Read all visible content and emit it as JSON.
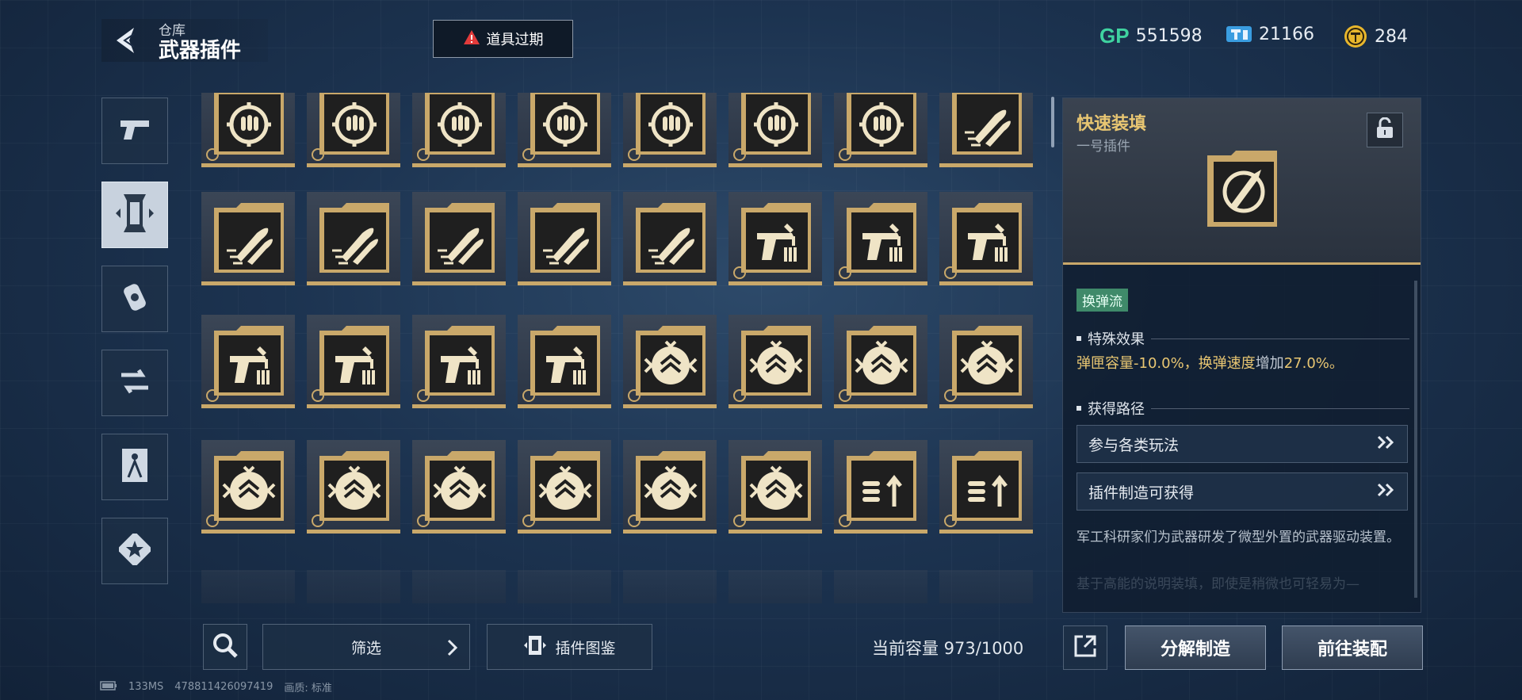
{
  "header": {
    "breadcrumb": "仓库",
    "title": "武器插件",
    "expired_label": "道具过期"
  },
  "currencies": [
    {
      "icon": "gp-icon",
      "value": "551598"
    },
    {
      "icon": "ticket-icon",
      "value": "21166"
    },
    {
      "icon": "coin-icon",
      "value": "284"
    }
  ],
  "categories": [
    {
      "icon": "pistol-icon",
      "active": false
    },
    {
      "icon": "plugin-icon",
      "active": true
    },
    {
      "icon": "grenade-icon",
      "active": false
    },
    {
      "icon": "swap-icon",
      "active": false
    },
    {
      "icon": "figure-icon",
      "active": false
    },
    {
      "icon": "star-icon",
      "active": false
    }
  ],
  "plugins": {
    "rows": [
      [
        "target-ammo",
        "target-ammo",
        "target-ammo",
        "target-ammo",
        "target-ammo",
        "target-ammo",
        "target-ammo",
        "twin-bullets"
      ],
      [
        "twin-bullets",
        "twin-bullets",
        "twin-bullets",
        "twin-bullets",
        "twin-bullets",
        "pistol-mag",
        "pistol-mag",
        "pistol-mag"
      ],
      [
        "pistol-mag",
        "pistol-mag",
        "pistol-mag",
        "pistol-mag",
        "chevron-shield",
        "chevron-shield",
        "chevron-shield",
        "chevron-shield"
      ],
      [
        "chevron-shield",
        "chevron-shield",
        "chevron-shield",
        "chevron-shield",
        "chevron-shield",
        "chevron-shield",
        "ammo-up",
        "ammo-up"
      ]
    ],
    "badges": [
      [
        true,
        true,
        true,
        true,
        true,
        true,
        true,
        false
      ],
      [
        false,
        false,
        false,
        false,
        false,
        true,
        true,
        true
      ],
      [
        true,
        true,
        true,
        true,
        true,
        true,
        true,
        true
      ],
      [
        true,
        true,
        true,
        true,
        true,
        true,
        true,
        true
      ]
    ]
  },
  "detail": {
    "name": "快速装填",
    "slot": "一号插件",
    "tag": "换弹流",
    "special_title": "特殊效果",
    "effect_a": "弹匣容量-10.0%，换弹速度",
    "effect_mid": "增加",
    "effect_b": "27.0%。",
    "route_title": "获得路径",
    "routes": [
      "参与各类玩法",
      "插件制造可获得"
    ],
    "description": "军工科研家们为武器研发了微型外置的武器驱动装置。",
    "description_fade": "基于高能的说明装填，即使是稍微也可轻易为—"
  },
  "bottom": {
    "filter_label": "筛选",
    "codex_label": "插件图鉴",
    "capacity_label": "当前容量 973/1000",
    "disassemble_label": "分解制造",
    "equip_label": "前往装配"
  },
  "footer": {
    "ping": "133MS",
    "id": "478811426097419",
    "quality_label": "画质:",
    "quality_value": "标准"
  },
  "colors": {
    "accent_gold": "#c9a86a",
    "effect_yellow": "#e8c672",
    "tag_green": "#3f8a6a"
  }
}
